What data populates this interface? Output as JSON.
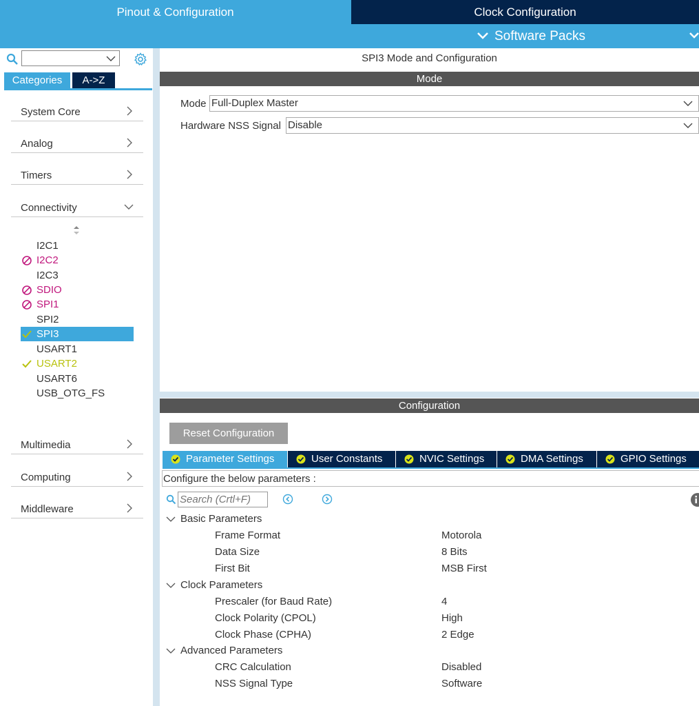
{
  "top_tabs": {
    "pinout": "Pinout & Configuration",
    "clock": "Clock Configuration"
  },
  "software_packs": "Software Packs",
  "sidebar": {
    "search_value": "",
    "tabs": {
      "categories": "Categories",
      "az": "A->Z"
    },
    "categories": [
      {
        "label": "System Core",
        "expanded": false
      },
      {
        "label": "Analog",
        "expanded": false
      },
      {
        "label": "Timers",
        "expanded": false
      },
      {
        "label": "Connectivity",
        "expanded": true
      },
      {
        "label": "Multimedia",
        "expanded": false
      },
      {
        "label": "Computing",
        "expanded": false
      },
      {
        "label": "Middleware",
        "expanded": false
      }
    ],
    "connectivity_items": [
      {
        "label": "I2C1",
        "status": "none"
      },
      {
        "label": "I2C2",
        "status": "disabled"
      },
      {
        "label": "I2C3",
        "status": "none"
      },
      {
        "label": "SDIO",
        "status": "disabled"
      },
      {
        "label": "SPI1",
        "status": "disabled"
      },
      {
        "label": "SPI2",
        "status": "none"
      },
      {
        "label": "SPI3",
        "status": "ok",
        "selected": true
      },
      {
        "label": "USART1",
        "status": "none"
      },
      {
        "label": "USART2",
        "status": "ok"
      },
      {
        "label": "USART6",
        "status": "none"
      },
      {
        "label": "USB_OTG_FS",
        "status": "none"
      }
    ]
  },
  "main": {
    "title": "SPI3 Mode and Configuration",
    "mode_header": "Mode",
    "mode_label": "Mode",
    "mode_value": "Full-Duplex Master",
    "nss_label": "Hardware NSS Signal",
    "nss_value": "Disable",
    "config_header": "Configuration",
    "reset_button": "Reset Configuration",
    "config_tabs": [
      {
        "label": "Parameter Settings",
        "active": true
      },
      {
        "label": "User Constants",
        "active": false
      },
      {
        "label": "NVIC Settings",
        "active": false
      },
      {
        "label": "DMA Settings",
        "active": false
      },
      {
        "label": "GPIO Settings",
        "active": false
      }
    ],
    "hint": "Configure the below parameters :",
    "search_placeholder": "Search (Crtl+F)",
    "groups": [
      {
        "label": "Basic Parameters",
        "params": [
          {
            "name": "Frame Format",
            "value": "Motorola"
          },
          {
            "name": "Data Size",
            "value": "8 Bits"
          },
          {
            "name": "First Bit",
            "value": "MSB First"
          }
        ]
      },
      {
        "label": "Clock Parameters",
        "params": [
          {
            "name": "Prescaler (for Baud Rate)",
            "value": "4"
          },
          {
            "name": "Clock Polarity (CPOL)",
            "value": "High"
          },
          {
            "name": "Clock Phase (CPHA)",
            "value": "2 Edge"
          }
        ]
      },
      {
        "label": "Advanced Parameters",
        "params": [
          {
            "name": "CRC Calculation",
            "value": "Disabled"
          },
          {
            "name": "NSS Signal Type",
            "value": "Software"
          }
        ]
      }
    ]
  },
  "colors": {
    "accent_blue": "#3ea8dc",
    "dark_navy": "#03234b",
    "disabled_magenta": "#c0167c",
    "ok_green": "#b9c20e",
    "header_gray": "#555555"
  }
}
